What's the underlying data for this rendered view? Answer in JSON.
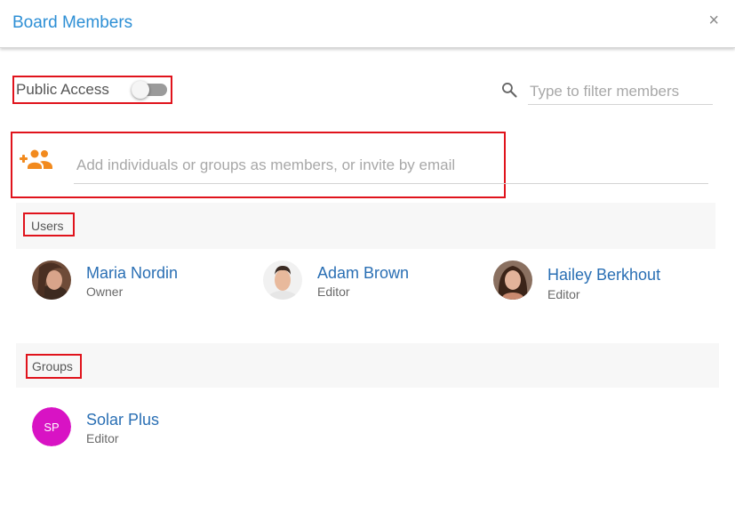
{
  "dialog": {
    "title": "Board Members",
    "close_glyph": "×"
  },
  "public_access": {
    "label": "Public Access",
    "enabled": false
  },
  "filter": {
    "placeholder": "Type to filter members",
    "icon": "search-icon"
  },
  "add_members": {
    "placeholder": "Add individuals or groups as members, or invite by email",
    "icon": "add-group-icon",
    "icon_color": "#f28a1e"
  },
  "users": {
    "label": "Users",
    "items": [
      {
        "name": "Maria Nordin",
        "role": "Owner"
      },
      {
        "name": "Adam Brown",
        "role": "Editor"
      },
      {
        "name": "Hailey Berkhout",
        "role": "Editor"
      }
    ]
  },
  "groups": {
    "label": "Groups",
    "items": [
      {
        "name": "Solar Plus",
        "role": "Editor",
        "initials": "SP",
        "color": "#d813c4"
      }
    ]
  },
  "colors": {
    "accent": "#2d8fd5",
    "link": "#2a6fb4",
    "highlight_border": "#e0131c"
  }
}
